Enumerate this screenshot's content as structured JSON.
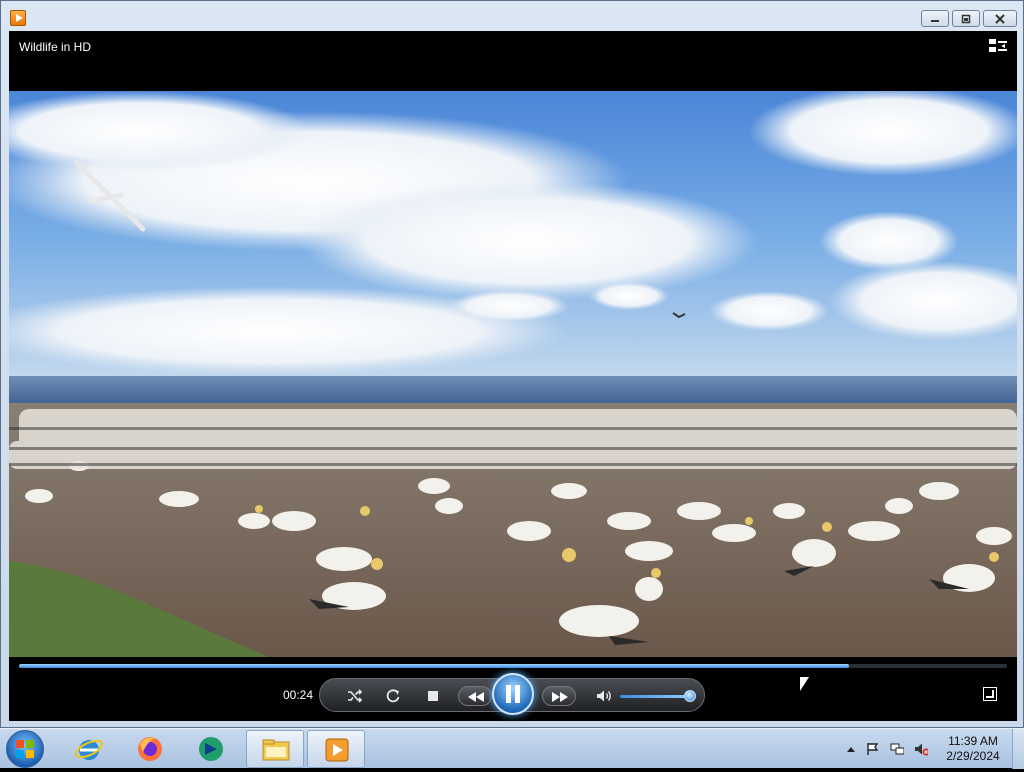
{
  "window": {
    "title": "Wildlife in HD",
    "buttons": [
      "minimize",
      "restore",
      "close"
    ]
  },
  "player": {
    "now_playing": "Wildlife in HD",
    "elapsed": "00:24",
    "progress_fraction": 0.84,
    "volume_fraction": 1.0,
    "state": "playing",
    "controls": {
      "shuffle": "shuffle-icon",
      "repeat": "repeat-icon",
      "stop": "stop-icon",
      "previous": "previous-icon",
      "play_pause": "pause-icon",
      "next": "next-icon",
      "mute": "speaker-icon"
    },
    "accent": "#3a8fe0"
  },
  "taskbar": {
    "pinned": [
      {
        "name": "internet-explorer-icon"
      },
      {
        "name": "firefox-icon"
      },
      {
        "name": "app-icon"
      },
      {
        "name": "file-explorer-icon"
      },
      {
        "name": "media-player-icon"
      }
    ],
    "clock": {
      "time": "11:39 AM",
      "date": "2/29/2024"
    }
  }
}
